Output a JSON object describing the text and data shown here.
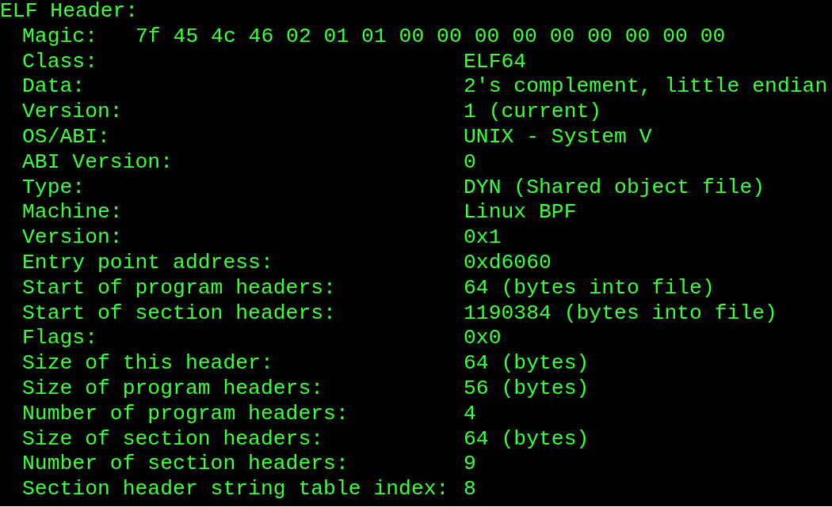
{
  "heading": "ELF Header:",
  "fields": [
    {
      "kind": "magic",
      "label": "Magic:",
      "value": "7f 45 4c 46 02 01 01 00 00 00 00 00 00 00 00 00"
    },
    {
      "kind": "field",
      "label": "Class:",
      "value": "ELF64"
    },
    {
      "kind": "field",
      "label": "Data:",
      "value": "2's complement, little endian"
    },
    {
      "kind": "field",
      "label": "Version:",
      "value": "1 (current)"
    },
    {
      "kind": "field",
      "label": "OS/ABI:",
      "value": "UNIX - System V"
    },
    {
      "kind": "field",
      "label": "ABI Version:",
      "value": "0"
    },
    {
      "kind": "field",
      "label": "Type:",
      "value": "DYN (Shared object file)"
    },
    {
      "kind": "field",
      "label": "Machine:",
      "value": "Linux BPF"
    },
    {
      "kind": "field",
      "label": "Version:",
      "value": "0x1"
    },
    {
      "kind": "field",
      "label": "Entry point address:",
      "value": "0xd6060"
    },
    {
      "kind": "field",
      "label": "Start of program headers:",
      "value": "64 (bytes into file)"
    },
    {
      "kind": "field",
      "label": "Start of section headers:",
      "value": "1190384 (bytes into file)"
    },
    {
      "kind": "field",
      "label": "Flags:",
      "value": "0x0"
    },
    {
      "kind": "field",
      "label": "Size of this header:",
      "value": "64 (bytes)"
    },
    {
      "kind": "field",
      "label": "Size of program headers:",
      "value": "56 (bytes)"
    },
    {
      "kind": "field",
      "label": "Number of program headers:",
      "value": "4"
    },
    {
      "kind": "field",
      "label": "Size of section headers:",
      "value": "64 (bytes)"
    },
    {
      "kind": "field",
      "label": "Number of section headers:",
      "value": "9"
    },
    {
      "kind": "field",
      "label": "Section header string table index:",
      "value": "8"
    }
  ]
}
